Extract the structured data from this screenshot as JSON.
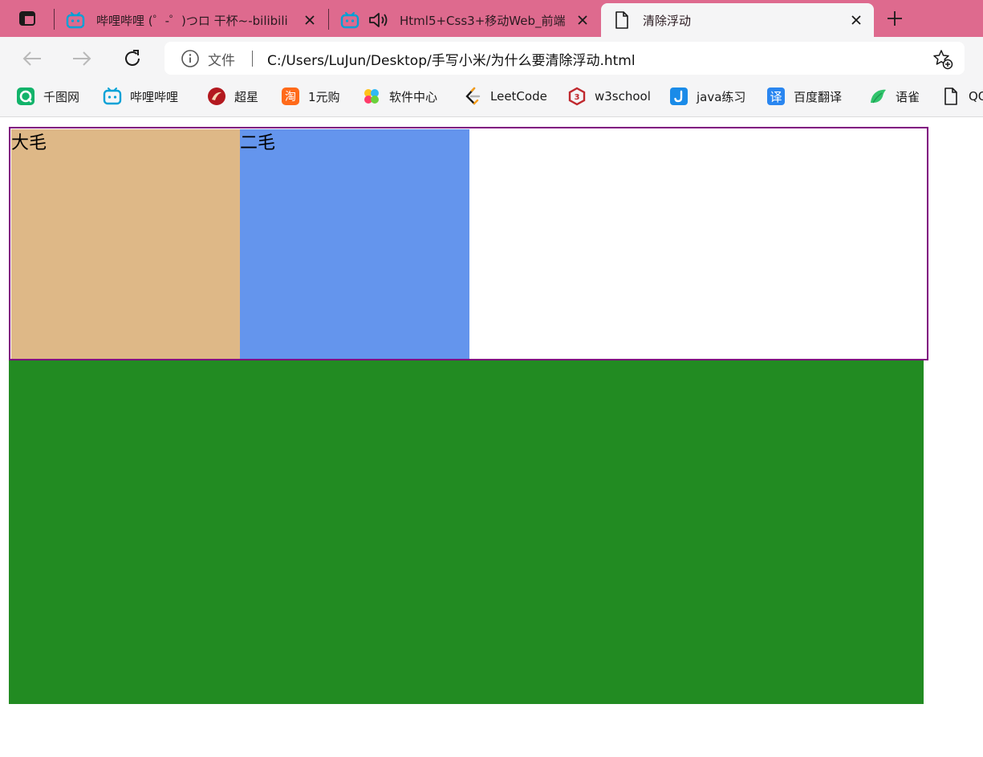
{
  "tabs": [
    {
      "title": "哔哩哔哩 (゜-゜)つロ 干杯~-bilibili",
      "icon": "bilibili-icon",
      "active": false
    },
    {
      "title": "Html5+Css3+移动Web_前端",
      "icon": "bilibili-icon",
      "audio": true,
      "active": false
    },
    {
      "title": "清除浮动",
      "icon": "document-icon",
      "active": true
    }
  ],
  "toolbar": {
    "file_label": "文件",
    "url": "C:/Users/LuJun/Desktop/手写小米/为什么要清除浮动.html"
  },
  "bookmarks": [
    {
      "label": "千图网",
      "icon": "qiantu-icon"
    },
    {
      "label": "哔哩哔哩",
      "icon": "bilibili-icon"
    },
    {
      "label": "超星",
      "icon": "chaoxing-icon"
    },
    {
      "label": "1元购",
      "icon": "taobao-icon"
    },
    {
      "label": "软件中心",
      "icon": "software-center-icon"
    },
    {
      "label": "LeetCode",
      "icon": "leetcode-icon"
    },
    {
      "label": "w3school",
      "icon": "w3school-icon"
    },
    {
      "label": "java练习",
      "icon": "java-icon"
    },
    {
      "label": "百度翻译",
      "icon": "baidu-translate-icon"
    },
    {
      "label": "语雀",
      "icon": "yuque-icon"
    },
    {
      "label": "QQ",
      "icon": "document-icon"
    }
  ],
  "page": {
    "box1_text": "大毛",
    "box2_text": "二毛"
  },
  "colors": {
    "tabstrip": "#de6a8e",
    "father_border": "#800080",
    "box1": "#deb887",
    "box2": "#6495ed",
    "green_block": "#228b22"
  }
}
